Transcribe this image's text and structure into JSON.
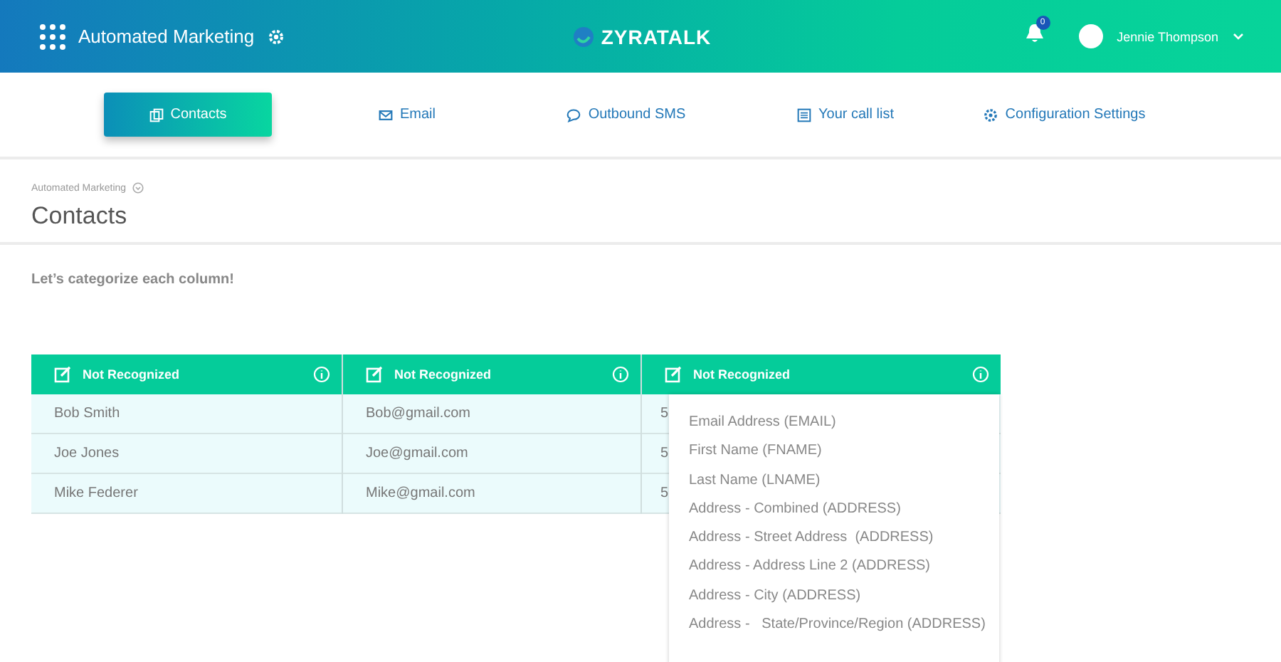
{
  "header": {
    "app_title": "Automated Marketing",
    "logo_text": "ZYRATALK",
    "notification_count": "0",
    "user_name": "Jennie Thompson"
  },
  "tabs": [
    {
      "label": "Contacts",
      "kind": "copy",
      "selected": true
    },
    {
      "label": "Email",
      "kind": "mail",
      "selected": false
    },
    {
      "label": "Outbound SMS",
      "kind": "chat",
      "selected": false
    },
    {
      "label": "Your call list",
      "kind": "list",
      "selected": false
    },
    {
      "label": "Configuration Settings",
      "kind": "gear",
      "selected": false
    }
  ],
  "breadcrumb": "Automated Marketing",
  "page_title": "Contacts",
  "instruction": "Let’s categorize each column!",
  "table": {
    "columns": [
      {
        "label": "Not Recognized"
      },
      {
        "label": "Not Recognized"
      },
      {
        "label": "Not Recognized"
      }
    ],
    "rows": [
      [
        "Bob Smith",
        "Bob@gmail.com",
        "5"
      ],
      [
        "Joe Jones",
        "Joe@gmail.com",
        "5"
      ],
      [
        "Mike Federer",
        "Mike@gmail.com",
        "5"
      ]
    ]
  },
  "dropdown": {
    "options": [
      "Email Address (EMAIL)",
      "First Name (FNAME)",
      "Last Name (LNAME)",
      "Address - Combined (ADDRESS)",
      "Address - Street Address  (ADDRESS)",
      "Address - Address Line 2 (ADDRESS)",
      "Address - City (ADDRESS)",
      "Address -   State/Province/Region (ADDRESS)"
    ]
  }
}
